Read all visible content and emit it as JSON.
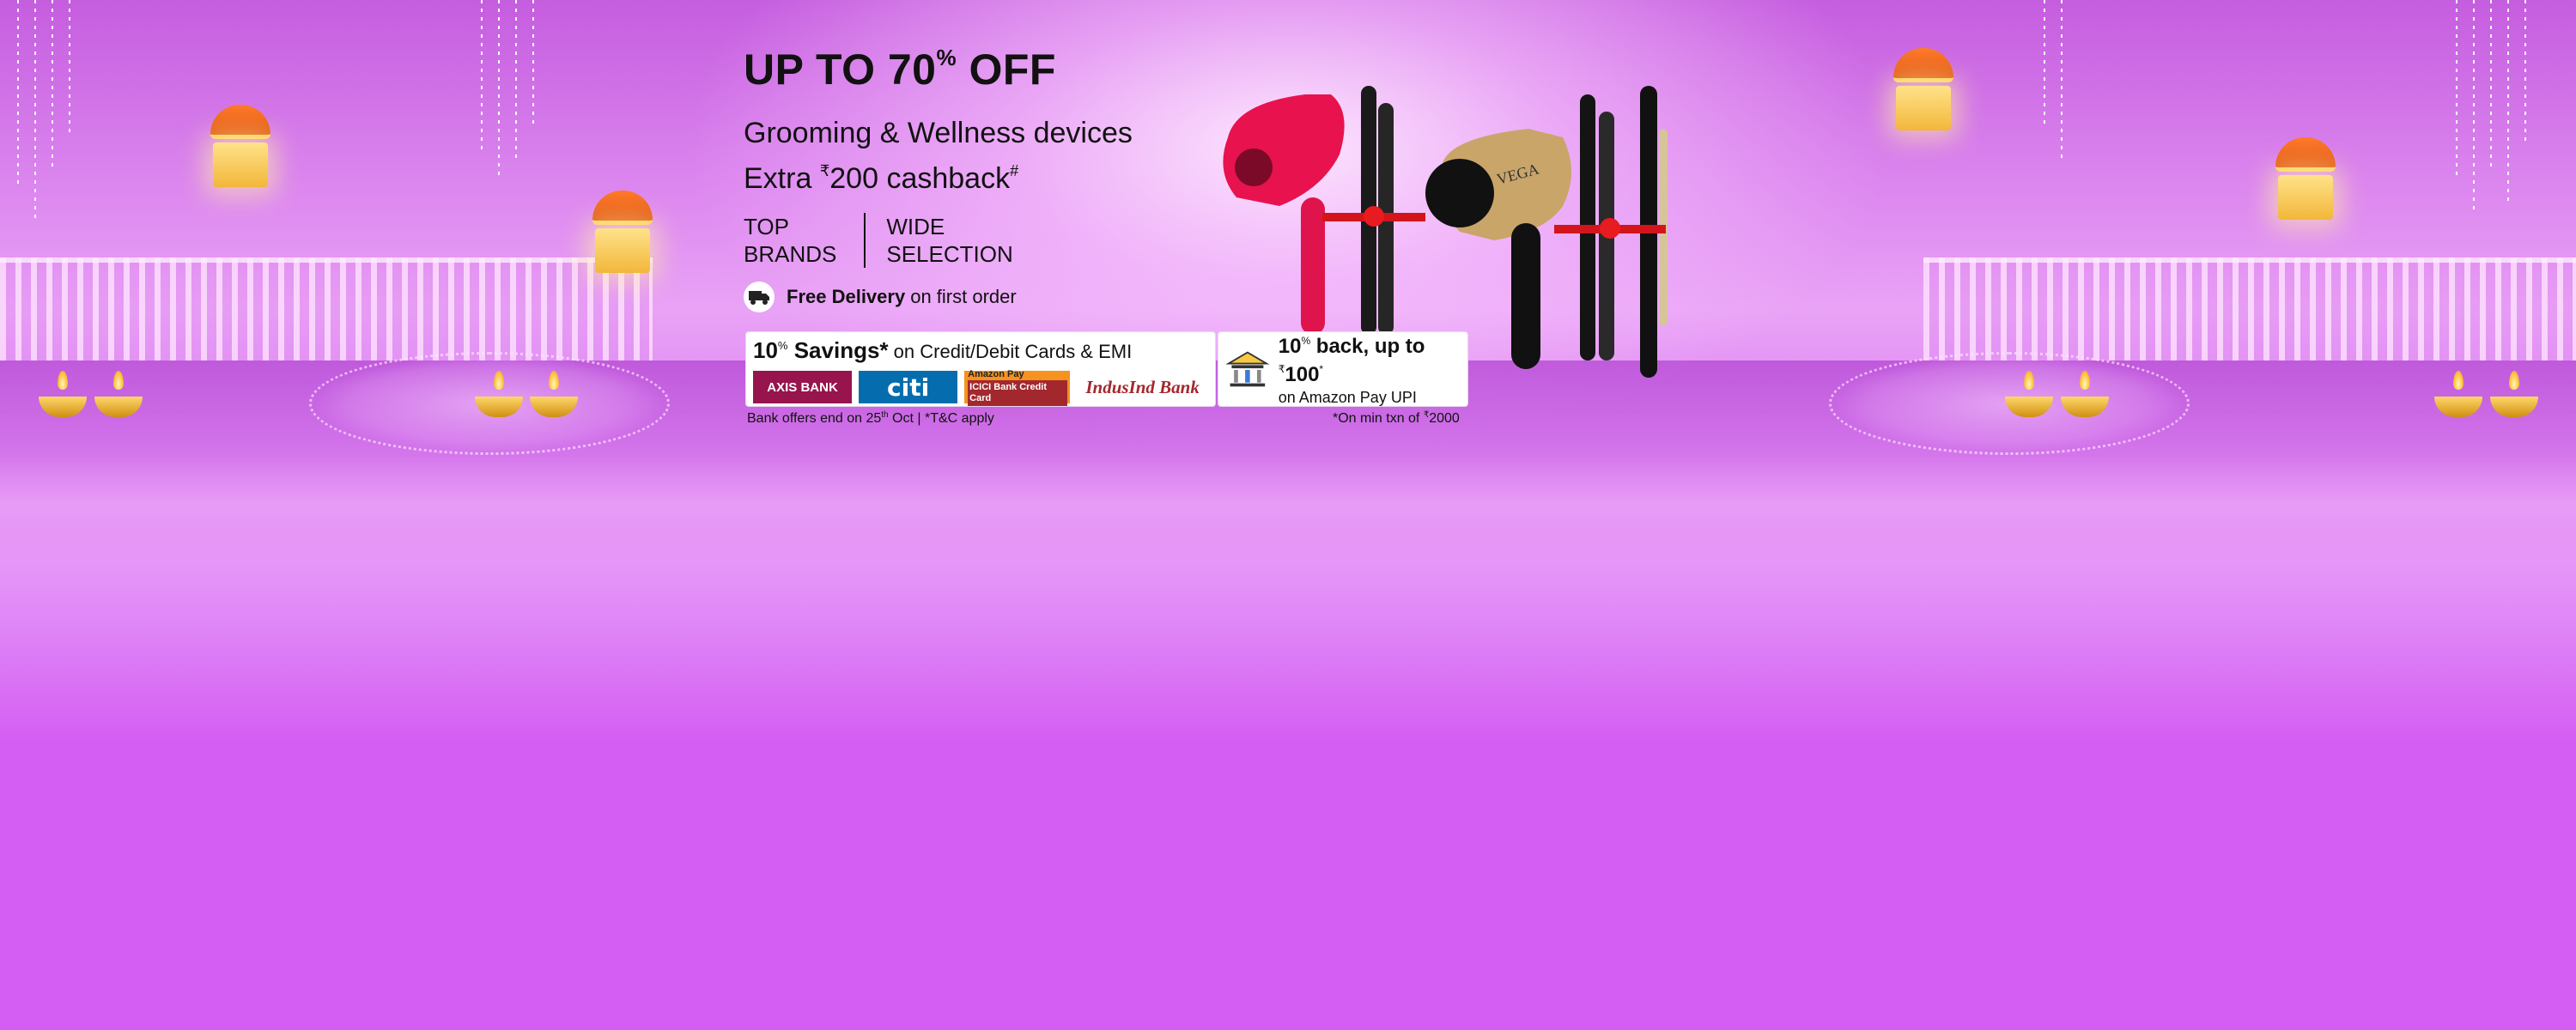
{
  "banner": {
    "headline_prefix": "UP TO 70",
    "headline_percent": "%",
    "headline_suffix": " OFF",
    "subline": "Grooming & Wellness devices",
    "cashback_prefix": "Extra ",
    "cashback_rupee": "₹",
    "cashback_amount": "200 cashback",
    "cashback_mark": "#",
    "badges": [
      {
        "label": "TOP\nBRANDS"
      },
      {
        "label": "WIDE\nSELECTION"
      }
    ],
    "delivery_bold": "Free Delivery",
    "delivery_rest": "on first order"
  },
  "offers": {
    "bank": {
      "pct": "10",
      "pct_sign": "%",
      "title": " Savings*",
      "rest": " on Credit/Debit Cards & EMI",
      "logos": {
        "axis": "AXIS BANK",
        "citi": "citi",
        "icici_top": "Amazon Pay",
        "icici_bottom": "ICICI Bank Credit Card",
        "indus": "IndusInd Bank"
      }
    },
    "upi": {
      "pct": "10",
      "pct_sign": "%",
      "title": " back, up to ",
      "rupee": "₹",
      "amount": "100",
      "mark": "*",
      "sub": "on Amazon Pay UPI"
    },
    "fineprint_left_a": "Bank offers end on 25",
    "fineprint_left_sup": "th",
    "fineprint_left_b": " Oct | *T&C apply",
    "fineprint_right_a": "*On min txn of ",
    "fineprint_right_sup": "₹",
    "fineprint_right_b": "2000"
  },
  "product_brand": "VEGA",
  "colors": {
    "background": "#d45ef3",
    "axis": "#97144d",
    "citi": "#056dae",
    "icici": "#f6921e",
    "indus": "#a3282d"
  }
}
